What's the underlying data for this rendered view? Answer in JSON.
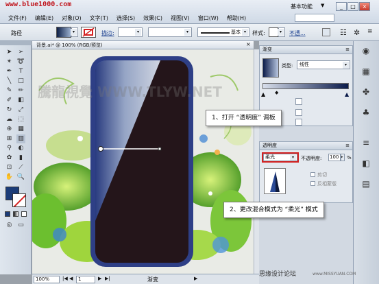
{
  "watermark_top": "www.blue1000.com",
  "menu": [
    "文件(F)",
    "编辑(E)",
    "对象(O)",
    "文字(T)",
    "选择(S)",
    "效果(C)",
    "视图(V)",
    "窗口(W)",
    "帮助(H)"
  ],
  "workspace": "基本功能",
  "window_buttons": [
    "_",
    "□",
    "×"
  ],
  "control_bar": {
    "object_label": "路径",
    "stroke_label": "描边:",
    "stroke_style": "基本",
    "style_label": "样式:",
    "opacity_label": "不透...",
    "colors": {
      "fill": "#1b3c78",
      "stroke": "#d42020"
    }
  },
  "document_tab": "背景.ai* @ 100% (RGB/预览)",
  "canvas_watermark": "騰龍視覺 WWW.TLYW.NET",
  "gradient_panel": {
    "title": "渐变",
    "type_label": "类型:",
    "type_value": "线性"
  },
  "transparency_panel": {
    "title": "透明度",
    "blend_mode": "柔光",
    "opacity_label": "不透明度:",
    "opacity_value": "100",
    "opacity_unit": "%",
    "clip_label": "剪切",
    "invert_label": "反相蒙版"
  },
  "callouts": {
    "step1": "1、打开 “透明度” 调板",
    "step2": "2、更改混合模式为 “柔光” 模式"
  },
  "status": {
    "zoom": "100%",
    "page": "1",
    "tool": "渐变"
  },
  "watermark_bottom": "思缘设计论坛",
  "watermark_bottom_url": "www.MISSYUAN.COM"
}
